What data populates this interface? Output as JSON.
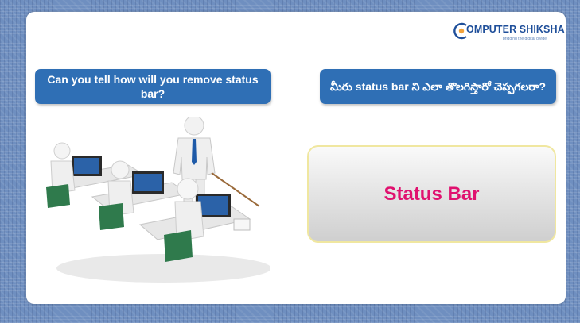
{
  "brand": {
    "name_first_letter": "C",
    "name_rest": "OMPUTER SHIKSHA",
    "tagline": "bridging the digital divide"
  },
  "question_english": "Can you tell how will you remove status bar?",
  "question_telugu": "మీరు status bar ని ఎలా తొలగిస్తారో చెప్పగలరా?",
  "answer": "Status Bar",
  "colors": {
    "background": "#6f8fc0",
    "question_box": "#2f6fb5",
    "answer_text": "#e0116f",
    "brand_text": "#1f4f9a"
  },
  "icons": [
    "computer-shiksha-logo",
    "classroom-illustration"
  ]
}
